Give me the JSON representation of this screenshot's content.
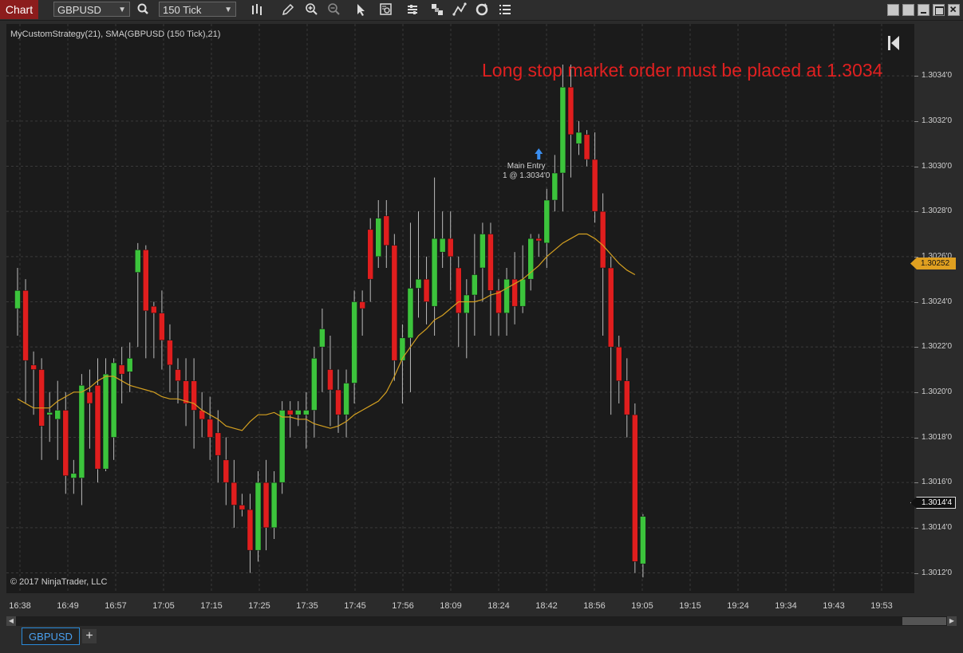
{
  "window": {
    "tab_label": "Chart",
    "instrument": "GBPUSD",
    "interval": "150 Tick"
  },
  "icons": [
    "bar-type-icon",
    "pencil-icon",
    "zoom-in-icon",
    "zoom-out-icon",
    "pointer-icon",
    "data-box-icon",
    "strategies-icon",
    "indicators-icon",
    "drawing-tools-icon",
    "reload-icon",
    "properties-icon",
    "back-to-start-icon",
    "search-icon"
  ],
  "colors": {
    "up": "#3cc43c",
    "down": "#e01e1e",
    "sma": "#d4a020",
    "annotation": "#e02020",
    "tab": "#8c1c1c",
    "entry_arrow": "#3a8ef0"
  },
  "chart": {
    "title": "MyCustomStrategy(21), SMA(GBPUSD (150 Tick),21)",
    "annotation": "Long stop market order must be placed at 1.3034",
    "entry_label_line1": "Main Entry",
    "entry_label_line2": "1 @ 1.3034'0",
    "copyright": "© 2017 NinjaTrader, LLC",
    "sma_value": "1.30252",
    "last_price": "1.3014'4"
  },
  "chart_data": {
    "type": "candlestick",
    "title": "MyCustomStrategy(21), SMA(GBPUSD (150 Tick),21)",
    "y_tick_labels": [
      "1.3034'0",
      "1.3032'0",
      "1.3030'0",
      "1.3028'0",
      "1.3026'0",
      "1.3024'0",
      "1.3022'0",
      "1.3020'0",
      "1.3018'0",
      "1.3016'0",
      "1.3014'0",
      "1.3012'0"
    ],
    "y_ticks": [
      1.3034,
      1.3032,
      1.303,
      1.3028,
      1.3026,
      1.3024,
      1.3022,
      1.302,
      1.3018,
      1.3016,
      1.3014,
      1.3012
    ],
    "ylim": [
      1.30111,
      1.30363
    ],
    "x_tick_labels": [
      "16:38",
      "16:49",
      "16:57",
      "17:05",
      "17:15",
      "17:25",
      "17:35",
      "17:45",
      "17:56",
      "18:09",
      "18:24",
      "18:42",
      "18:56",
      "19:05",
      "19:15",
      "19:24",
      "19:34",
      "19:43",
      "19:53"
    ],
    "grid": true,
    "candles": [
      [
        1.30237,
        1.30245,
        1.30225,
        1.30255
      ],
      [
        1.30245,
        1.30214,
        1.30195,
        1.3025
      ],
      [
        1.30212,
        1.3021,
        1.3019,
        1.30218
      ],
      [
        1.3021,
        1.30185,
        1.3017,
        1.30215
      ],
      [
        1.3019,
        1.30191,
        1.30178,
        1.302
      ],
      [
        1.30188,
        1.30192,
        1.3017,
        1.30205
      ],
      [
        1.30192,
        1.30163,
        1.30155,
        1.302
      ],
      [
        1.30162,
        1.30164,
        1.30155,
        1.3017
      ],
      [
        1.30162,
        1.30203,
        1.3015,
        1.30208
      ],
      [
        1.302,
        1.30195,
        1.30175,
        1.3021
      ],
      [
        1.30203,
        1.30166,
        1.3016,
        1.30215
      ],
      [
        1.30166,
        1.30208,
        1.30165,
        1.30215
      ],
      [
        1.3018,
        1.30213,
        1.3017,
        1.30215
      ],
      [
        1.30212,
        1.30208,
        1.30195,
        1.3022
      ],
      [
        1.30209,
        1.30215,
        1.302,
        1.30222
      ],
      [
        1.30253,
        1.30263,
        1.3022,
        1.30266
      ],
      [
        1.30263,
        1.30236,
        1.30215,
        1.30265
      ],
      [
        1.30238,
        1.30235,
        1.30215,
        1.3024
      ],
      [
        1.30235,
        1.30223,
        1.3021,
        1.30245
      ],
      [
        1.30223,
        1.30212,
        1.302,
        1.3023
      ],
      [
        1.3021,
        1.30205,
        1.30195,
        1.30215
      ],
      [
        1.30205,
        1.30195,
        1.30185,
        1.30215
      ],
      [
        1.30205,
        1.30192,
        1.30175,
        1.30215
      ],
      [
        1.30192,
        1.30188,
        1.3018,
        1.302
      ],
      [
        1.30188,
        1.3018,
        1.3017,
        1.30198
      ],
      [
        1.30182,
        1.30172,
        1.3016,
        1.30192
      ],
      [
        1.3017,
        1.3016,
        1.3015,
        1.3018
      ],
      [
        1.3016,
        1.3015,
        1.3014,
        1.3017
      ],
      [
        1.3015,
        1.30148,
        1.30145,
        1.30155
      ],
      [
        1.30148,
        1.3013,
        1.3012,
        1.30155
      ],
      [
        1.3013,
        1.3016,
        1.30125,
        1.30165
      ],
      [
        1.3016,
        1.3014,
        1.3013,
        1.3017
      ],
      [
        1.3014,
        1.3016,
        1.30135,
        1.30165
      ],
      [
        1.3016,
        1.30192,
        1.30155,
        1.30196
      ],
      [
        1.30192,
        1.3019,
        1.3018,
        1.30196
      ],
      [
        1.3019,
        1.30192,
        1.30185,
        1.30196
      ],
      [
        1.3019,
        1.30192,
        1.30175,
        1.302
      ],
      [
        1.30192,
        1.30215,
        1.3018,
        1.3022
      ],
      [
        1.3022,
        1.30228,
        1.302,
        1.30237
      ],
      [
        1.3021,
        1.30201,
        1.30185,
        1.30225
      ],
      [
        1.30201,
        1.3019,
        1.30182,
        1.3021
      ],
      [
        1.3019,
        1.30204,
        1.3018,
        1.3021
      ],
      [
        1.30204,
        1.3024,
        1.30195,
        1.30245
      ],
      [
        1.3024,
        1.30237,
        1.30225,
        1.30245
      ],
      [
        1.30272,
        1.3025,
        1.3024,
        1.30277
      ],
      [
        1.3026,
        1.30277,
        1.30255,
        1.30285
      ],
      [
        1.30278,
        1.30265,
        1.30255,
        1.30285
      ],
      [
        1.30265,
        1.30214,
        1.30205,
        1.3027
      ],
      [
        1.30214,
        1.30224,
        1.30195,
        1.3023
      ],
      [
        1.30224,
        1.30246,
        1.302,
        1.30275
      ],
      [
        1.30246,
        1.3025,
        1.30233,
        1.3028
      ],
      [
        1.3025,
        1.3024,
        1.3023,
        1.3026
      ],
      [
        1.30238,
        1.30268,
        1.30225,
        1.30295
      ],
      [
        1.30262,
        1.30268,
        1.30255,
        1.3028
      ],
      [
        1.30268,
        1.3026,
        1.30245,
        1.3028
      ],
      [
        1.30255,
        1.30235,
        1.3022,
        1.3026
      ],
      [
        1.30235,
        1.30243,
        1.30215,
        1.3025
      ],
      [
        1.30243,
        1.30252,
        1.30225,
        1.3027
      ],
      [
        1.30255,
        1.3027,
        1.3024,
        1.30275
      ],
      [
        1.3027,
        1.30245,
        1.30225,
        1.30275
      ],
      [
        1.30245,
        1.30235,
        1.30225,
        1.3025
      ],
      [
        1.30235,
        1.3025,
        1.30225,
        1.30255
      ],
      [
        1.3025,
        1.30238,
        1.3023,
        1.30262
      ],
      [
        1.30238,
        1.3025,
        1.30235,
        1.30265
      ],
      [
        1.3025,
        1.30268,
        1.30245,
        1.3027
      ],
      [
        1.30268,
        1.30267,
        1.3026,
        1.3027
      ],
      [
        1.30266,
        1.30285,
        1.30255,
        1.3029
      ],
      [
        1.30285,
        1.30297,
        1.3028,
        1.30305
      ],
      [
        1.30297,
        1.30335,
        1.3028,
        1.30345
      ],
      [
        1.30335,
        1.30314,
        1.30295,
        1.30345
      ],
      [
        1.3031,
        1.30315,
        1.30305,
        1.3032
      ],
      [
        1.30314,
        1.30303,
        1.303,
        1.30316
      ],
      [
        1.30303,
        1.3028,
        1.30275,
        1.30315
      ],
      [
        1.3028,
        1.30255,
        1.30225,
        1.30288
      ],
      [
        1.30255,
        1.3022,
        1.3019,
        1.3026
      ],
      [
        1.3022,
        1.30205,
        1.30195,
        1.30225
      ],
      [
        1.30205,
        1.3019,
        1.3018,
        1.30215
      ],
      [
        1.3019,
        1.30125,
        1.3012,
        1.30195
      ],
      [
        1.30124,
        1.30145,
        1.30118,
        1.30146
      ]
    ],
    "sma": [
      1.30197,
      1.30195,
      1.30193,
      1.30193,
      1.30193,
      1.30196,
      1.30198,
      1.302,
      1.302,
      1.30202,
      1.30205,
      1.30207,
      1.30207,
      1.30205,
      1.30203,
      1.30202,
      1.30201,
      1.302,
      1.30198,
      1.30197,
      1.30197,
      1.30196,
      1.30195,
      1.30192,
      1.3019,
      1.30188,
      1.30185,
      1.30184,
      1.30183,
      1.30187,
      1.3019,
      1.3019,
      1.30191,
      1.30189,
      1.30189,
      1.30188,
      1.30188,
      1.30186,
      1.30185,
      1.30184,
      1.30185,
      1.30187,
      1.3019,
      1.30192,
      1.30194,
      1.30196,
      1.302,
      1.30207,
      1.30215,
      1.3022,
      1.30225,
      1.30228,
      1.30232,
      1.30234,
      1.30237,
      1.3024,
      1.3024,
      1.3024,
      1.30241,
      1.30243,
      1.30244,
      1.30246,
      1.30248,
      1.3025,
      1.30253,
      1.30256,
      1.3026,
      1.30263,
      1.30266,
      1.30268,
      1.3027,
      1.3027,
      1.30268,
      1.30265,
      1.30261,
      1.30257,
      1.30254,
      1.30252
    ],
    "entry": {
      "label": "Main Entry",
      "detail": "1 @ 1.3034'0"
    }
  }
}
